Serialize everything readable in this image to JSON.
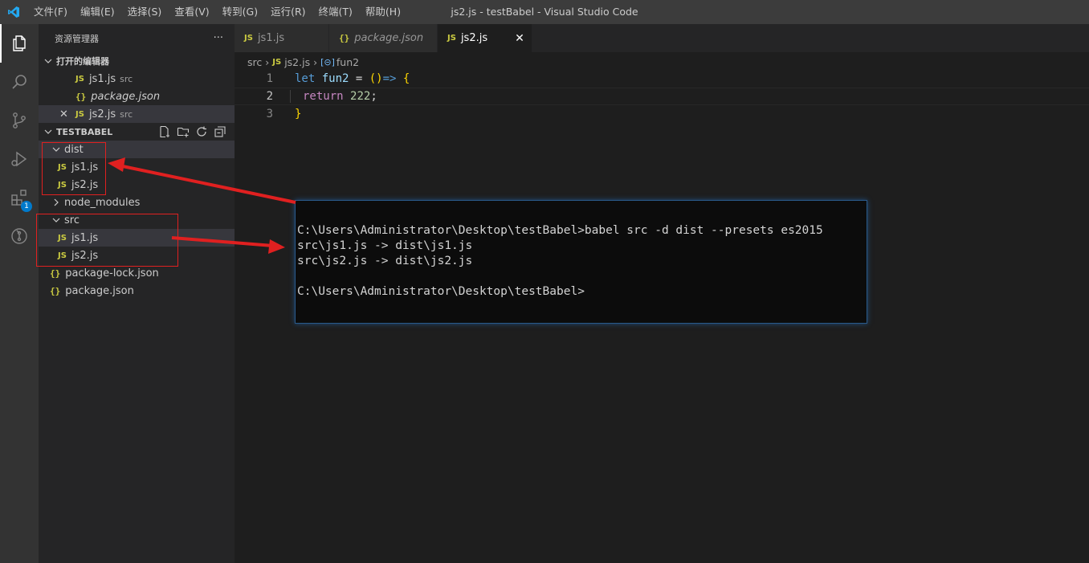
{
  "titlebar": {
    "menu": [
      "文件(F)",
      "编辑(E)",
      "选择(S)",
      "查看(V)",
      "转到(G)",
      "运行(R)",
      "终端(T)",
      "帮助(H)"
    ],
    "window_title": "js2.js - testBabel - Visual Studio Code"
  },
  "activitybar": {
    "items": [
      "explorer-icon",
      "search-icon",
      "source-control-icon",
      "run-debug-icon",
      "extensions-icon",
      "git-graph-icon"
    ],
    "extensions_badge": "1"
  },
  "sidebar": {
    "title": "资源管理器",
    "more": "···",
    "open_editors": {
      "header": "打开的编辑器",
      "items": [
        {
          "icon": "JS",
          "name": "js1.js",
          "desc": "src"
        },
        {
          "icon": "{}",
          "name": "package.json",
          "desc": ""
        },
        {
          "icon": "JS",
          "name": "js2.js",
          "desc": "src"
        }
      ]
    },
    "workspace": {
      "header": "TESTBABEL",
      "tree": [
        {
          "type": "folder",
          "name": "dist",
          "expanded": true
        },
        {
          "type": "file",
          "icon": "JS",
          "name": "js1.js"
        },
        {
          "type": "file",
          "icon": "JS",
          "name": "js2.js"
        },
        {
          "type": "folder",
          "name": "node_modules",
          "expanded": false
        },
        {
          "type": "folder",
          "name": "src",
          "expanded": true
        },
        {
          "type": "file",
          "icon": "JS",
          "name": "js1.js"
        },
        {
          "type": "file",
          "icon": "JS",
          "name": "js2.js"
        },
        {
          "type": "file",
          "icon": "{}",
          "name": "package-lock.json"
        },
        {
          "type": "file",
          "icon": "{}",
          "name": "package.json"
        }
      ]
    }
  },
  "tabs": [
    {
      "icon": "JS",
      "label": "js1.js"
    },
    {
      "icon": "{}",
      "label": "package.json"
    },
    {
      "icon": "JS",
      "label": "js2.js",
      "close": "✕"
    }
  ],
  "breadcrumb": {
    "folder": "src",
    "file_icon": "JS",
    "file": "js2.js",
    "symbol": "fun2"
  },
  "code": {
    "line_numbers": [
      "1",
      "2",
      "3"
    ],
    "line1": {
      "kw": "let",
      "name": "fun2",
      "eq": " = ",
      "paren": "()",
      "arrow": "=>",
      "brace": "{"
    },
    "line2": {
      "kw": "return",
      "value": "222",
      "semi": ";"
    },
    "line3": {
      "brace": "}"
    }
  },
  "terminal": {
    "lines": [
      "C:\\Users\\Administrator\\Desktop\\testBabel>babel src -d dist --presets es2015",
      "src\\js1.js -> dist\\js1.js",
      "src\\js2.js -> dist\\js2.js",
      "",
      "C:\\Users\\Administrator\\Desktop\\testBabel>"
    ]
  },
  "colors": {
    "accent": "#007acc",
    "annotation_red": "#e02020",
    "js_icon": "#cbcb41"
  }
}
